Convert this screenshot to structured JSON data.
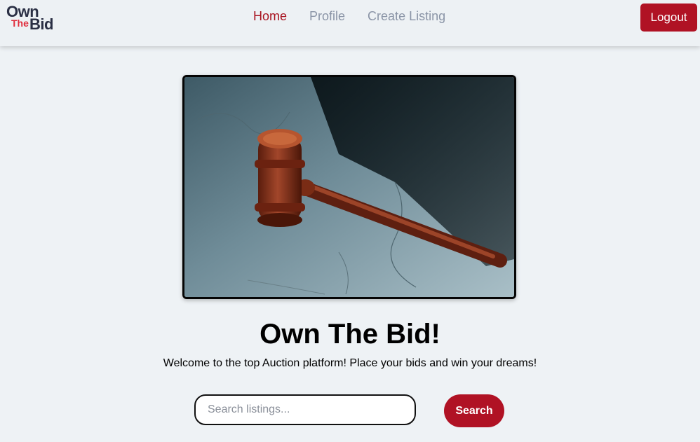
{
  "logo": {
    "line1": "Own",
    "line2": "The",
    "line3": "Bid"
  },
  "nav": {
    "links": [
      {
        "label": "Home",
        "active": true
      },
      {
        "label": "Profile",
        "active": false
      },
      {
        "label": "Create Listing",
        "active": false
      }
    ],
    "logout_label": "Logout"
  },
  "hero": {
    "image_icon": "gavel-image",
    "title": "Own The Bid!",
    "subtitle": "Welcome to the top Auction platform! Place your bids and win your dreams!"
  },
  "search": {
    "placeholder": "Search listings...",
    "value": "",
    "button_label": "Search"
  },
  "colors": {
    "accent": "#b01224",
    "active_link": "#a8121f",
    "inactive_link": "#8a94a6",
    "background": "#eef2f5"
  }
}
